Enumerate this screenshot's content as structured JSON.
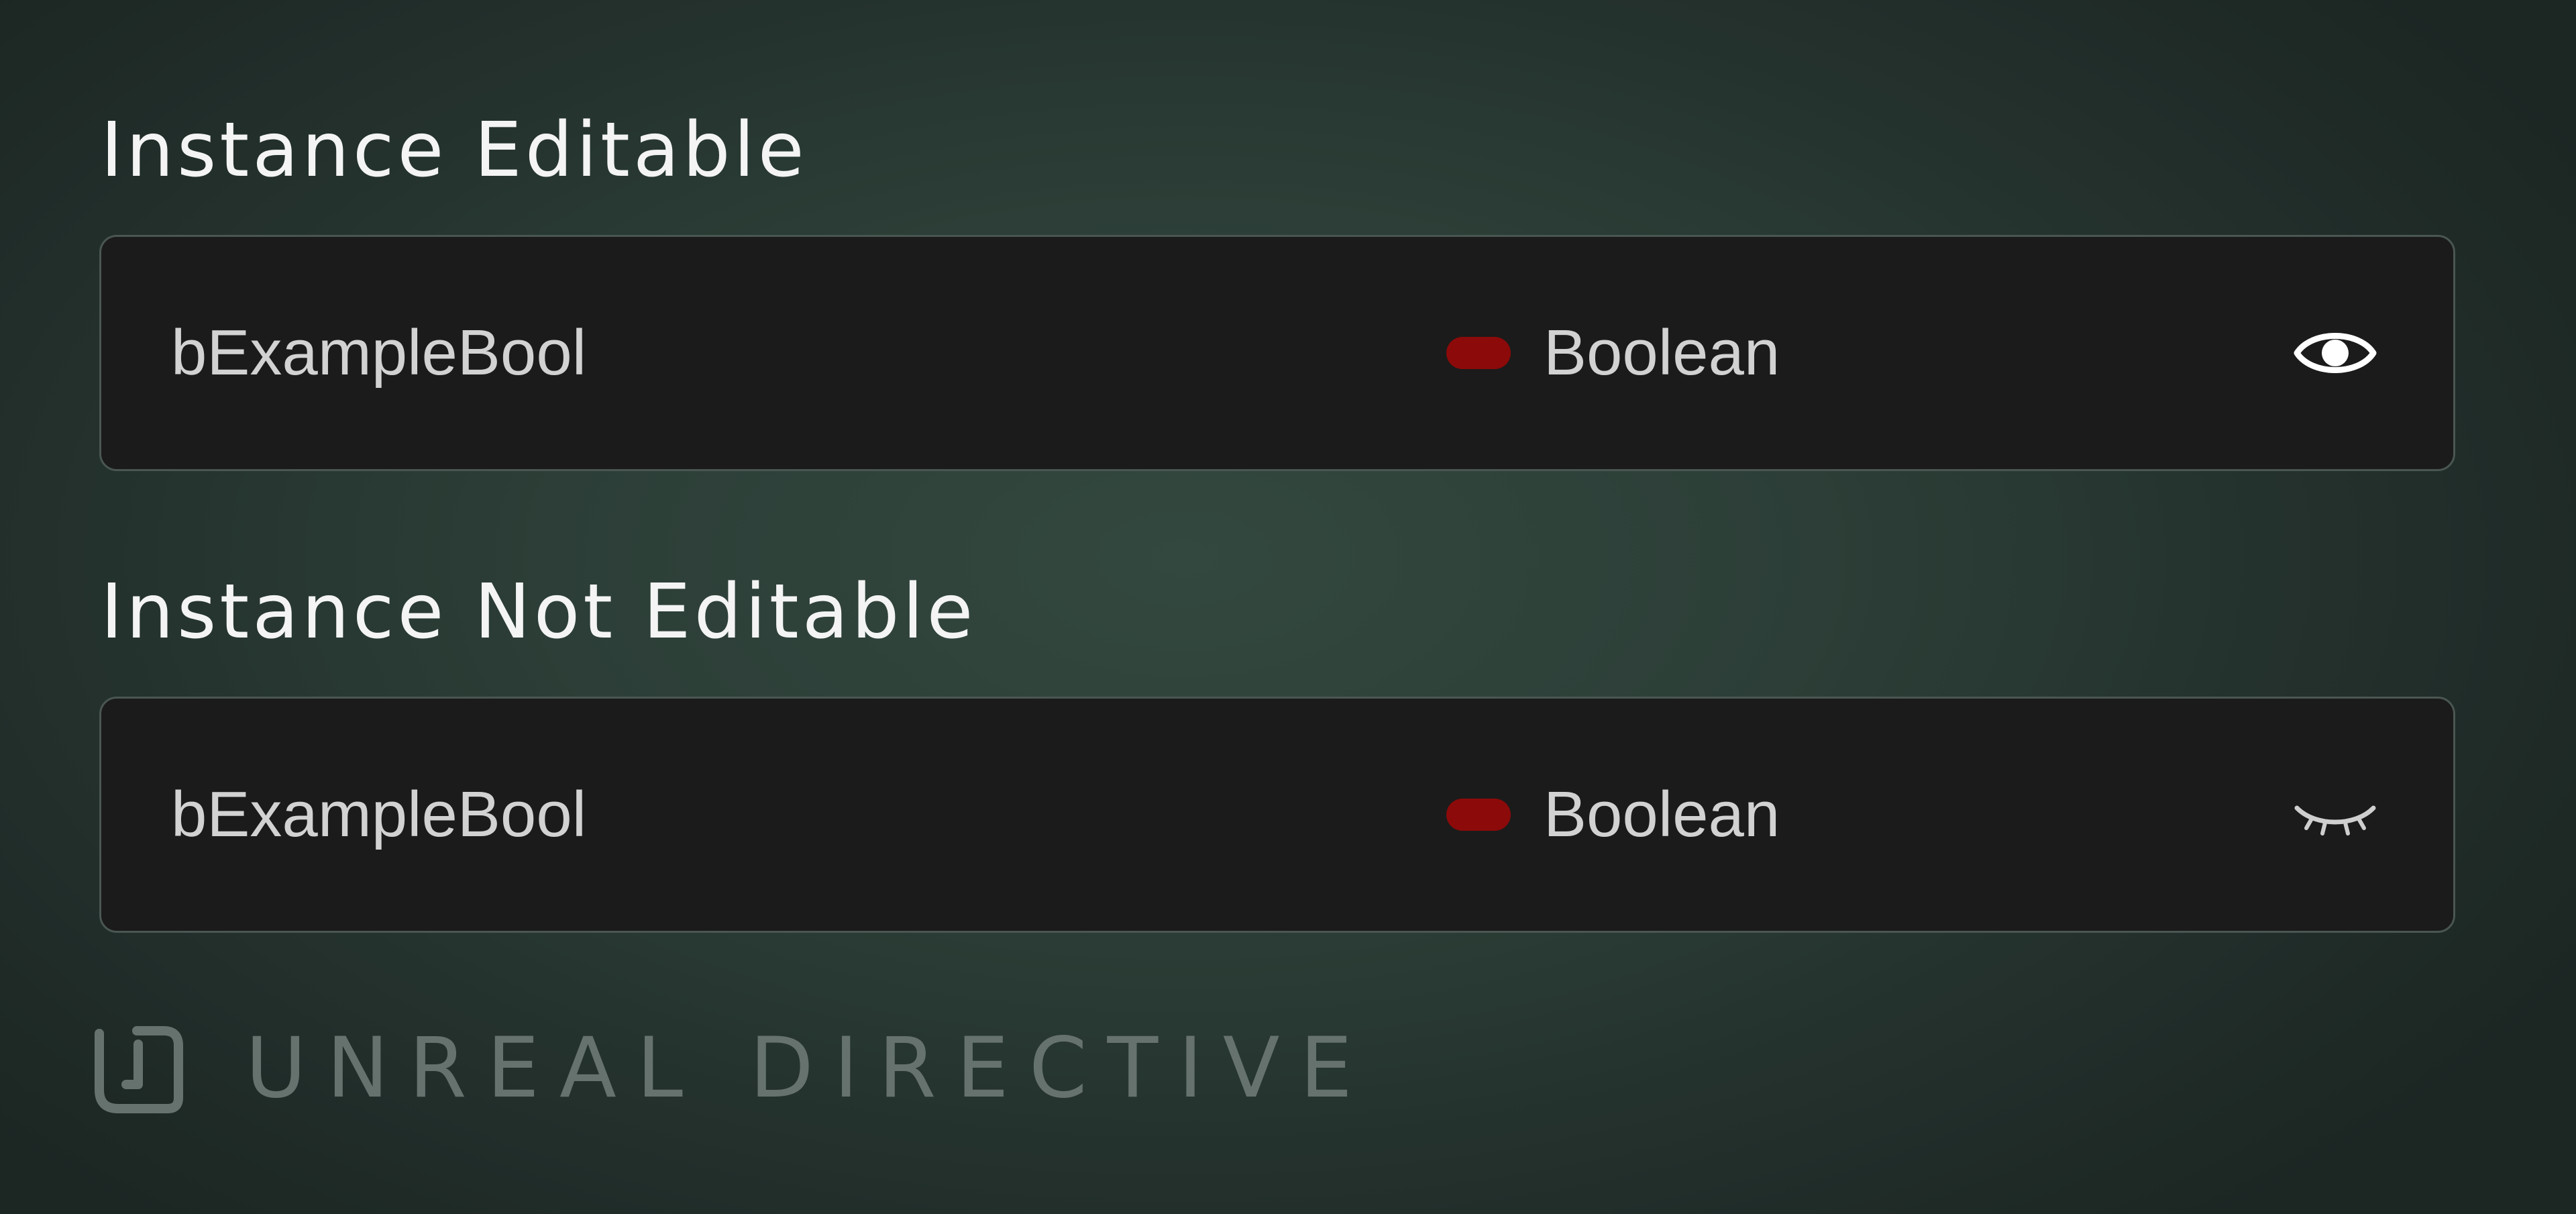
{
  "sections": [
    {
      "title": "Instance Editable",
      "variable": {
        "name": "bExampleBool",
        "type_label": "Boolean",
        "type_color": "#8c0a0a",
        "visibility_icon": "eye-open-icon"
      }
    },
    {
      "title": "Instance Not Editable",
      "variable": {
        "name": "bExampleBool",
        "type_label": "Boolean",
        "type_color": "#8c0a0a",
        "visibility_icon": "eye-closed-icon"
      }
    }
  ],
  "watermark": {
    "text": "UNREAL DIRECTIVE",
    "logo_icon": "unreal-directive-logo-icon"
  },
  "colors": {
    "background": "#2c3e37",
    "row_background": "#1b1b1b",
    "row_border": "#4a5652",
    "watermark": "#66726e"
  }
}
